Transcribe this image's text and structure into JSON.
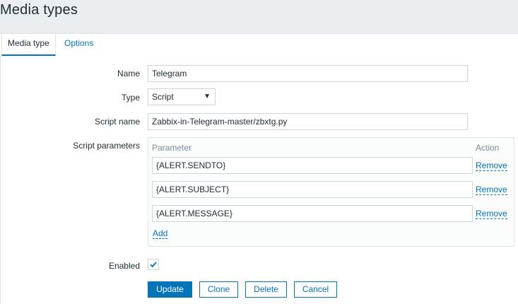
{
  "page": {
    "title": "Media types"
  },
  "tabs": [
    {
      "label": "Media type",
      "active": true
    },
    {
      "label": "Options",
      "active": false
    }
  ],
  "form": {
    "name": {
      "label": "Name",
      "value": "Telegram"
    },
    "type": {
      "label": "Type",
      "selected": "Script"
    },
    "script_name": {
      "label": "Script name",
      "value": "Zabbix-in-Telegram-master/zbxtg.py"
    },
    "script_parameters": {
      "label": "Script parameters",
      "column_parameter": "Parameter",
      "column_action": "Action",
      "rows": [
        {
          "value": "{ALERT.SENDTO}",
          "action": "Remove"
        },
        {
          "value": "{ALERT.SUBJECT}",
          "action": "Remove"
        },
        {
          "value": "{ALERT.MESSAGE}",
          "action": "Remove"
        }
      ],
      "add_label": "Add"
    },
    "enabled": {
      "label": "Enabled",
      "checked": true
    }
  },
  "buttons": {
    "update": "Update",
    "clone": "Clone",
    "delete": "Delete",
    "cancel": "Cancel"
  },
  "colors": {
    "accent": "#0275b8",
    "background": "#ebeef0",
    "border": "#cfd6da"
  },
  "icons": {
    "select_arrow": "caret-down-icon",
    "checkbox_mark": "checkmark-icon"
  }
}
